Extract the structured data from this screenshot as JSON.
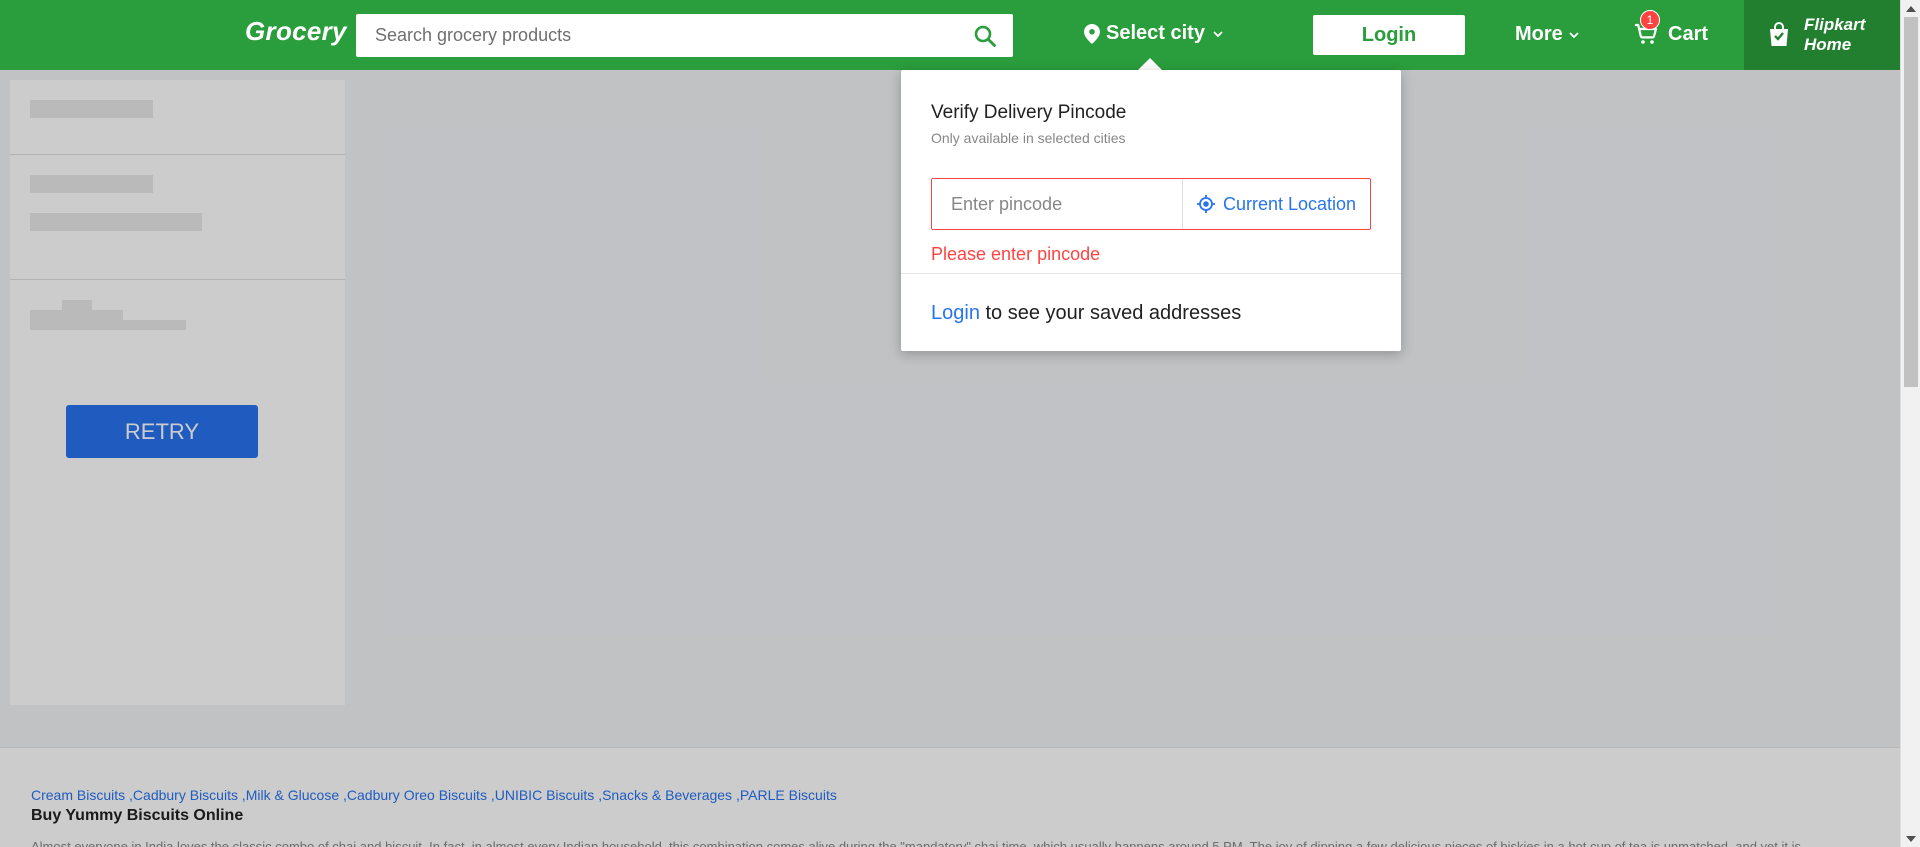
{
  "header": {
    "logo": "Grocery",
    "search_placeholder": "Search grocery products",
    "city_label": "Select city",
    "login_label": "Login",
    "more_label": "More",
    "cart_label": "Cart",
    "cart_count": "1",
    "home_label": "Flipkart\nHome",
    "colors": {
      "brand_green": "#2a9d3c",
      "home_bg": "#237f30"
    }
  },
  "sidebar": {
    "retry_label": "RETRY"
  },
  "popup": {
    "title": "Verify Delivery Pincode",
    "subtitle": "Only available in selected cities",
    "pincode_placeholder": "Enter pincode",
    "current_location_label": "Current Location",
    "error_text": "Please enter pincode",
    "login_link": "Login",
    "login_suffix": " to see your saved addresses"
  },
  "footer": {
    "links": [
      "Cream Biscuits ,",
      "Cadbury Biscuits ,",
      "Milk & Glucose ,",
      "Cadbury Oreo Biscuits ,",
      "UNIBIC Biscuits ,",
      "Snacks & Beverages ,",
      "PARLE Biscuits"
    ],
    "title": "Buy Yummy Biscuits Online",
    "description": "Almost everyone in India loves the classic combo of chai and biscuit. In fact, in almost every Indian household, this combination comes alive during the \"mandatory\" chai time, which usually happens around 5 PM. The joy of dipping a few delicious pieces of biskies in a hot cup of tea is unmatched, and yet it is"
  }
}
